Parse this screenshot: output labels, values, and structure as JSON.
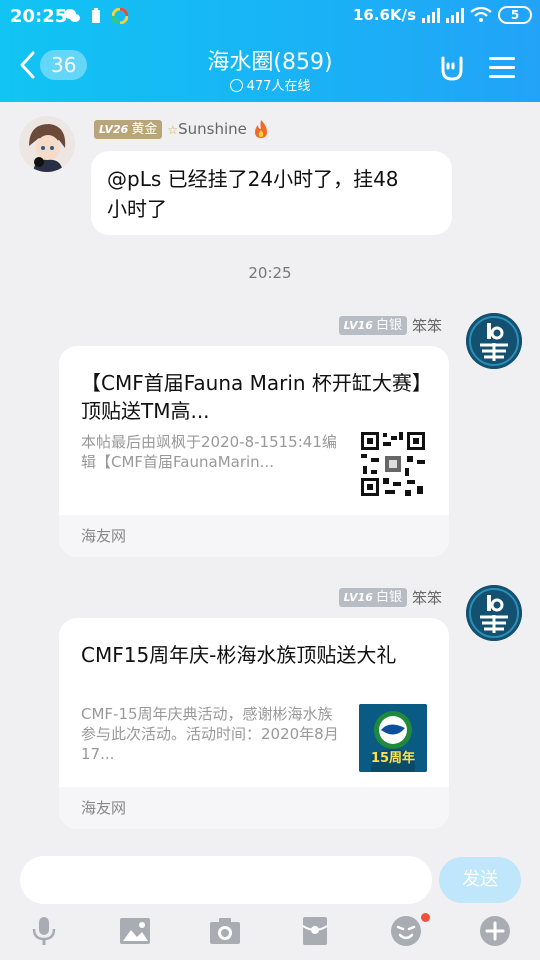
{
  "status_bar": {
    "time": "20:25",
    "speed": "16.6K/s",
    "battery": "5",
    "icons": [
      "wechat-icon",
      "battery-saver-icon",
      "color-app-icon",
      "hd-signal-icon",
      "hd-signal-icon",
      "wifi-icon"
    ]
  },
  "header": {
    "back_count": "36",
    "title": "海水圈(859)",
    "online": "477人在线",
    "icons": [
      "rock-hand-icon",
      "menu-icon"
    ]
  },
  "messages": [
    {
      "sender": "Sunshine",
      "badge_level": "LV26",
      "badge_rank": "黄金",
      "sender_prefix": "☆",
      "text": "@pLs 已经挂了24小时了，挂48小时了",
      "text_line1": "@pLs 已经挂了24小时了，挂48",
      "text_line2": "小时了"
    }
  ],
  "timestamp": "20:25",
  "cards": [
    {
      "sender": "笨笨",
      "badge_level": "LV16",
      "badge_rank": "白银",
      "title": "【CMF首届Fauna Marin 杯开缸大赛】顶贴送TM高...",
      "description": "本帖最后由飒枫于2020-8-1515:41编辑【CMF首届FaunaMarin...",
      "source": "海友网",
      "thumb": "qr-code-thumbnail"
    },
    {
      "sender": "笨笨",
      "badge_level": "LV16",
      "badge_rank": "白银",
      "title": "CMF15周年庆-彬海水族顶贴送大礼",
      "description": "CMF-15周年庆典活动，感谢彬海水族参与此次活动。活动时间：2020年8月17...",
      "source": "海友网",
      "thumb_text": "15周年"
    }
  ],
  "composer": {
    "placeholder": "",
    "send_label": "发送"
  },
  "toolbar": [
    "microphone-icon",
    "image-icon",
    "camera-icon",
    "red-packet-icon",
    "emoji-icon",
    "plus-icon"
  ],
  "colors": {
    "header_start": "#11c4f3",
    "header_end": "#22a3f7",
    "send_disabled": "#bfe6fa",
    "badge": "#b8bcc4",
    "notification_dot": "#f0503c"
  }
}
